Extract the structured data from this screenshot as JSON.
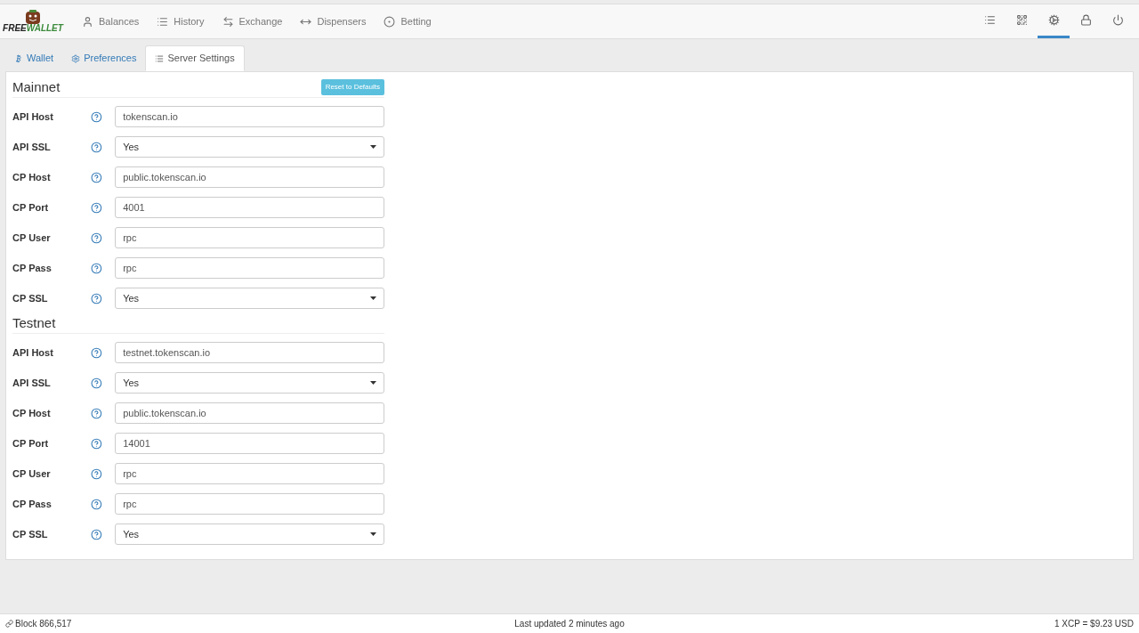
{
  "logo": {
    "first": "FREE",
    "second": "WALLET"
  },
  "nav": [
    {
      "label": "Balances"
    },
    {
      "label": "History"
    },
    {
      "label": "Exchange"
    },
    {
      "label": "Dispensers"
    },
    {
      "label": "Betting"
    }
  ],
  "toolbar": [
    {
      "selected": false
    },
    {
      "selected": false
    },
    {
      "selected": true
    },
    {
      "selected": false
    },
    {
      "selected": false
    }
  ],
  "tabs": [
    {
      "label": "Wallet",
      "selected": false
    },
    {
      "label": "Preferences",
      "selected": false
    },
    {
      "label": "Server Settings",
      "selected": true
    }
  ],
  "reset_button": "Reset to Defaults",
  "sections": [
    {
      "title": "Mainnet",
      "fields": [
        {
          "label": "API Host",
          "kind": "text",
          "value": "tokenscan.io"
        },
        {
          "label": "API SSL",
          "kind": "select",
          "value": "Yes"
        },
        {
          "label": "CP Host",
          "kind": "text",
          "value": "public.tokenscan.io"
        },
        {
          "label": "CP Port",
          "kind": "text",
          "value": "4001"
        },
        {
          "label": "CP User",
          "kind": "text",
          "value": "rpc"
        },
        {
          "label": "CP Pass",
          "kind": "text",
          "value": "rpc"
        },
        {
          "label": "CP SSL",
          "kind": "select",
          "value": "Yes"
        }
      ]
    },
    {
      "title": "Testnet",
      "fields": [
        {
          "label": "API Host",
          "kind": "text",
          "value": "testnet.tokenscan.io"
        },
        {
          "label": "API SSL",
          "kind": "select",
          "value": "Yes"
        },
        {
          "label": "CP Host",
          "kind": "text",
          "value": "public.tokenscan.io"
        },
        {
          "label": "CP Port",
          "kind": "text",
          "value": "14001"
        },
        {
          "label": "CP User",
          "kind": "text",
          "value": "rpc"
        },
        {
          "label": "CP Pass",
          "kind": "text",
          "value": "rpc"
        },
        {
          "label": "CP SSL",
          "kind": "select",
          "value": "Yes"
        }
      ]
    }
  ],
  "status_bar": {
    "block": "Block 866,517",
    "updated": "Last updated 2 minutes ago",
    "price": "1 XCP = $9.23 USD"
  }
}
